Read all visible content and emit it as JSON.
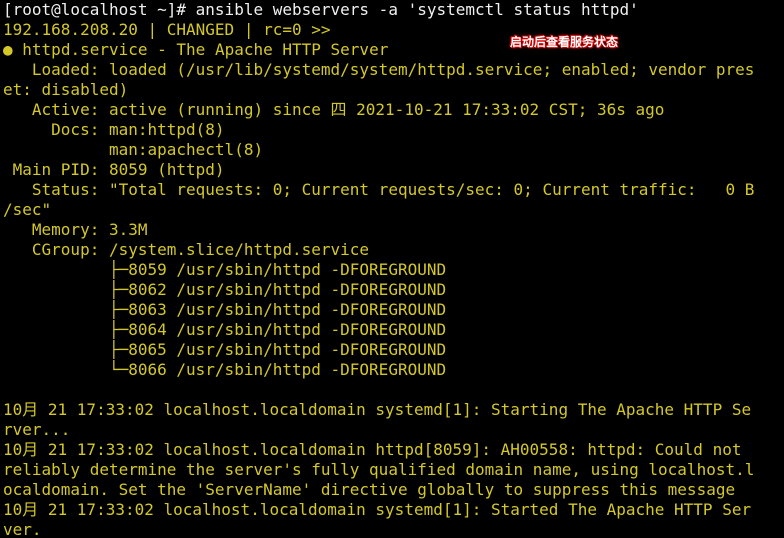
{
  "terminal": {
    "prompt_line": "[root@localhost ~]# ansible webservers -a 'systemctl status httpd'",
    "result_line": "192.168.208.20 | CHANGED | rc=0 >>",
    "status_lines": [
      "httpd.service - The Apache HTTP Server",
      "   Loaded: loaded (/usr/lib/systemd/system/httpd.service; enabled; vendor pres",
      "et: disabled)",
      "   Active: active (running) since 四 2021-10-21 17:33:02 CST; 36s ago",
      "     Docs: man:httpd(8)",
      "           man:apachectl(8)",
      " Main PID: 8059 (httpd)",
      "   Status: \"Total requests: 0; Current requests/sec: 0; Current traffic:   0 B",
      "/sec\"",
      "   Memory: 3.3M",
      "   CGroup: /system.slice/httpd.service",
      "           ├─8059 /usr/sbin/httpd -DFOREGROUND",
      "           ├─8062 /usr/sbin/httpd -DFOREGROUND",
      "           ├─8063 /usr/sbin/httpd -DFOREGROUND",
      "           ├─8064 /usr/sbin/httpd -DFOREGROUND",
      "           ├─8065 /usr/sbin/httpd -DFOREGROUND",
      "           └─8066 /usr/sbin/httpd -DFOREGROUND"
    ],
    "log_lines": [
      "10月 21 17:33:02 localhost.localdomain systemd[1]: Starting The Apache HTTP Se",
      "rver...",
      "10月 21 17:33:02 localhost.localdomain httpd[8059]: AH00558: httpd: Could not",
      "reliably determine the server's fully qualified domain name, using localhost.l",
      "ocaldomain. Set the 'ServerName' directive globally to suppress this message",
      "10月 21 17:33:02 localhost.localdomain systemd[1]: Started The Apache HTTP Ser",
      "ver."
    ],
    "bullet": "●"
  },
  "annotation": {
    "text": "启动后查看服务状态"
  },
  "colors": {
    "background": "#000000",
    "prompt": "#f0f0f0",
    "output": "#d4c828",
    "annotation_outline": "#d00000"
  }
}
